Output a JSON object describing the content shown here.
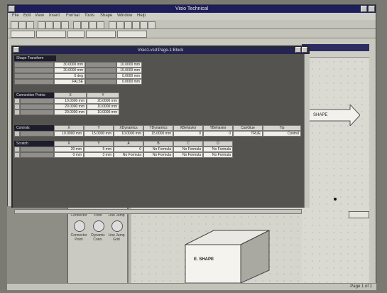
{
  "app": {
    "title": "Visio Technical",
    "menus": [
      "File",
      "Edit",
      "View",
      "Insert",
      "Format",
      "Tools",
      "Shape",
      "Window",
      "Help"
    ]
  },
  "sheet": {
    "title": "Visio1.vsd:Page-1:Block",
    "sections": {
      "shape_transform": "Shape Transform",
      "connection_points": "Connection Points",
      "controls": "Controls",
      "scratch": "Scratch"
    },
    "shape_transform_rows": [
      [
        "30.0000 mm",
        "",
        "10.0000 mm"
      ],
      [
        "20.0000 mm",
        "",
        "15.0000 mm"
      ],
      [
        "0 deg",
        "",
        "0.0000 mm"
      ],
      [
        "FALSE",
        "",
        "0.0000 mm"
      ]
    ],
    "connection_rows": [
      [
        "10.0000 mm",
        "20.0000 mm"
      ],
      [
        "20.0000 mm",
        "10.0000 mm"
      ],
      [
        "20.0000 mm",
        "10.0000 mm"
      ]
    ],
    "controls_headers": [
      "X",
      "Y",
      "XDynamics",
      "YDynamics",
      "XBehavior",
      "YBehavior",
      "CanGlue",
      "Tip"
    ],
    "controls_row": [
      "10.0000 mm",
      "15.0000 mm",
      "10.0000 mm",
      "15.0000 mm",
      "0",
      "0",
      "TRUE",
      "Control"
    ],
    "scratch_headers": [
      "X",
      "Y",
      "A",
      "B",
      "C",
      "D"
    ],
    "scratch_rows": [
      [
        "20 mm",
        "5 mm",
        "0",
        "No Formula",
        "No Formula",
        "No Formula"
      ],
      [
        "0 mm",
        "3 mm",
        "No Formula",
        "No Formula",
        "No Formula",
        "No Formula"
      ]
    ]
  },
  "canvas": {
    "arrow_label": "SHAPE",
    "box_label": "E. SHAPE"
  },
  "stencil": {
    "items": [
      "Connector",
      "Point",
      "Line Jump",
      "Connector Point",
      "Dynamic Conn.",
      "Line Jump Grid"
    ]
  },
  "status": {
    "text": "Page 1 of 1"
  },
  "colors": {
    "titlebar": "#1d1e5a",
    "sheet_bg": "#54534f",
    "canvas_bg": "#dad9d2"
  }
}
